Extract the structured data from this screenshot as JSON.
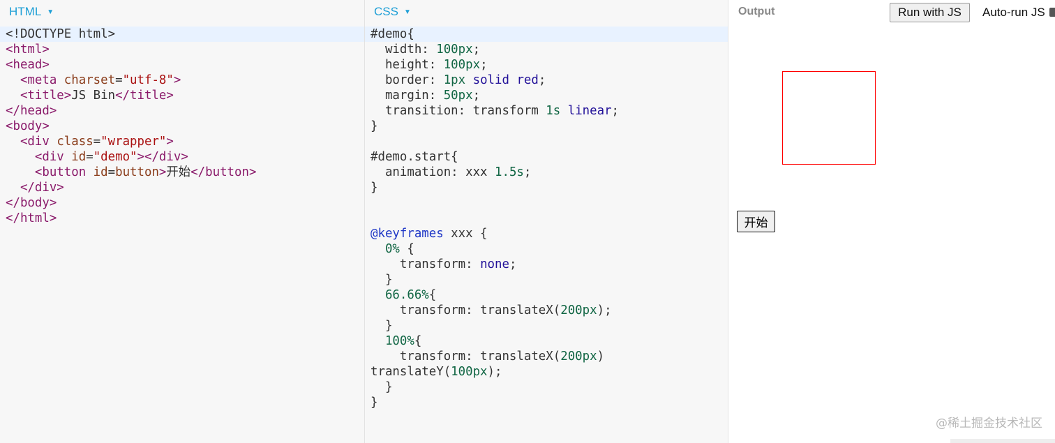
{
  "html_panel": {
    "title": "HTML",
    "lines": [
      [
        [
          "plain",
          "<!DOCTYPE html>"
        ]
      ],
      [
        [
          "tag",
          "<html>"
        ]
      ],
      [
        [
          "tag",
          "<head>"
        ]
      ],
      [
        [
          "plain",
          "  "
        ],
        [
          "tag",
          "<meta "
        ],
        [
          "attr",
          "charset"
        ],
        [
          "plain",
          "="
        ],
        [
          "str",
          "\"utf-8\""
        ],
        [
          "tag",
          ">"
        ]
      ],
      [
        [
          "plain",
          "  "
        ],
        [
          "tag",
          "<title>"
        ],
        [
          "plain",
          "JS Bin"
        ],
        [
          "tag",
          "</title>"
        ]
      ],
      [
        [
          "tag",
          "</head>"
        ]
      ],
      [
        [
          "tag",
          "<body>"
        ]
      ],
      [
        [
          "plain",
          "  "
        ],
        [
          "tag",
          "<div "
        ],
        [
          "attr",
          "class"
        ],
        [
          "plain",
          "="
        ],
        [
          "str",
          "\"wrapper\""
        ],
        [
          "tag",
          ">"
        ]
      ],
      [
        [
          "plain",
          "    "
        ],
        [
          "tag",
          "<div "
        ],
        [
          "attr",
          "id"
        ],
        [
          "plain",
          "="
        ],
        [
          "str",
          "\"demo\""
        ],
        [
          "tag",
          "></div>"
        ]
      ],
      [
        [
          "plain",
          "    "
        ],
        [
          "tag",
          "<button "
        ],
        [
          "attr",
          "id"
        ],
        [
          "plain",
          "="
        ],
        [
          "attr",
          "button"
        ],
        [
          "tag",
          ">"
        ],
        [
          "plain",
          "开始"
        ],
        [
          "tag",
          "</button>"
        ]
      ],
      [
        [
          "plain",
          "  "
        ],
        [
          "tag",
          "</div>"
        ]
      ],
      [
        [
          "tag",
          "</body>"
        ]
      ],
      [
        [
          "tag",
          "</html>"
        ]
      ]
    ]
  },
  "css_panel": {
    "title": "CSS",
    "lines": [
      [
        [
          "sel",
          "#demo{"
        ]
      ],
      [
        [
          "prop",
          "  width: "
        ],
        [
          "num",
          "100px"
        ],
        [
          "punc",
          ";"
        ]
      ],
      [
        [
          "prop",
          "  height: "
        ],
        [
          "num",
          "100px"
        ],
        [
          "punc",
          ";"
        ]
      ],
      [
        [
          "prop",
          "  border: "
        ],
        [
          "num",
          "1px"
        ],
        [
          "plain",
          " "
        ],
        [
          "kw",
          "solid"
        ],
        [
          "plain",
          " "
        ],
        [
          "kw",
          "red"
        ],
        [
          "punc",
          ";"
        ]
      ],
      [
        [
          "prop",
          "  margin: "
        ],
        [
          "num",
          "50px"
        ],
        [
          "punc",
          ";"
        ]
      ],
      [
        [
          "prop",
          "  transition: transform "
        ],
        [
          "num",
          "1s"
        ],
        [
          "plain",
          " "
        ],
        [
          "kw",
          "linear"
        ],
        [
          "punc",
          ";"
        ]
      ],
      [
        [
          "punc",
          "}"
        ]
      ],
      [
        [
          "plain",
          ""
        ]
      ],
      [
        [
          "sel",
          "#demo.start{"
        ]
      ],
      [
        [
          "prop",
          "  animation: xxx "
        ],
        [
          "num",
          "1.5s"
        ],
        [
          "punc",
          ";"
        ]
      ],
      [
        [
          "punc",
          "}"
        ]
      ],
      [
        [
          "plain",
          ""
        ]
      ],
      [
        [
          "plain",
          ""
        ]
      ],
      [
        [
          "at",
          "@keyframes"
        ],
        [
          "plain",
          " xxx {"
        ]
      ],
      [
        [
          "num",
          "  0%"
        ],
        [
          "plain",
          " {"
        ]
      ],
      [
        [
          "prop",
          "    transform: "
        ],
        [
          "kw",
          "none"
        ],
        [
          "punc",
          ";"
        ]
      ],
      [
        [
          "plain",
          "  }"
        ]
      ],
      [
        [
          "num",
          "  66.66%"
        ],
        [
          "plain",
          "{"
        ]
      ],
      [
        [
          "prop",
          "    transform: translateX("
        ],
        [
          "num",
          "200px"
        ],
        [
          "punc",
          ");"
        ]
      ],
      [
        [
          "plain",
          "  }"
        ]
      ],
      [
        [
          "num",
          "  100%"
        ],
        [
          "plain",
          "{"
        ]
      ],
      [
        [
          "prop",
          "    transform: translateX("
        ],
        [
          "num",
          "200px"
        ],
        [
          "punc",
          ")"
        ]
      ],
      [
        [
          "prop",
          "translateY("
        ],
        [
          "num",
          "100px"
        ],
        [
          "punc",
          ");"
        ]
      ],
      [
        [
          "plain",
          "  }"
        ]
      ],
      [
        [
          "punc",
          "}"
        ]
      ]
    ]
  },
  "output_panel": {
    "title": "Output",
    "run_button": "Run with JS",
    "autorun_label": "Auto-run JS",
    "start_button": "开始"
  },
  "watermark": "@稀土掘金技术社区",
  "colors": {
    "panel_title": "#1e9fd6",
    "demo_border": "#ff0000",
    "active_line": "#e8f2ff"
  }
}
